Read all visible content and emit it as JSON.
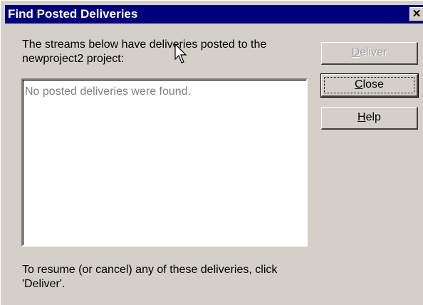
{
  "window": {
    "title": "Find Posted Deliveries",
    "close_glyph": "✕"
  },
  "main": {
    "description": "The streams below have deliveries posted to the newproject2 project:",
    "list_empty_text": "No posted deliveries were found.",
    "footer_text": "To resume (or cancel) any of these deliveries, click 'Deliver'."
  },
  "buttons": {
    "deliver": {
      "mnemonic": "D",
      "rest": "eliver",
      "enabled": false
    },
    "close": {
      "mnemonic": "C",
      "rest": "lose",
      "default": true
    },
    "help": {
      "mnemonic": "H",
      "rest": "elp"
    }
  },
  "icons": {
    "cursor": "mouse-pointer-icon",
    "close": "close-icon"
  },
  "colors": {
    "titlebar": "#00007b",
    "dialog_bg": "#d4d0c8",
    "disabled_text": "#a0a0a0"
  }
}
